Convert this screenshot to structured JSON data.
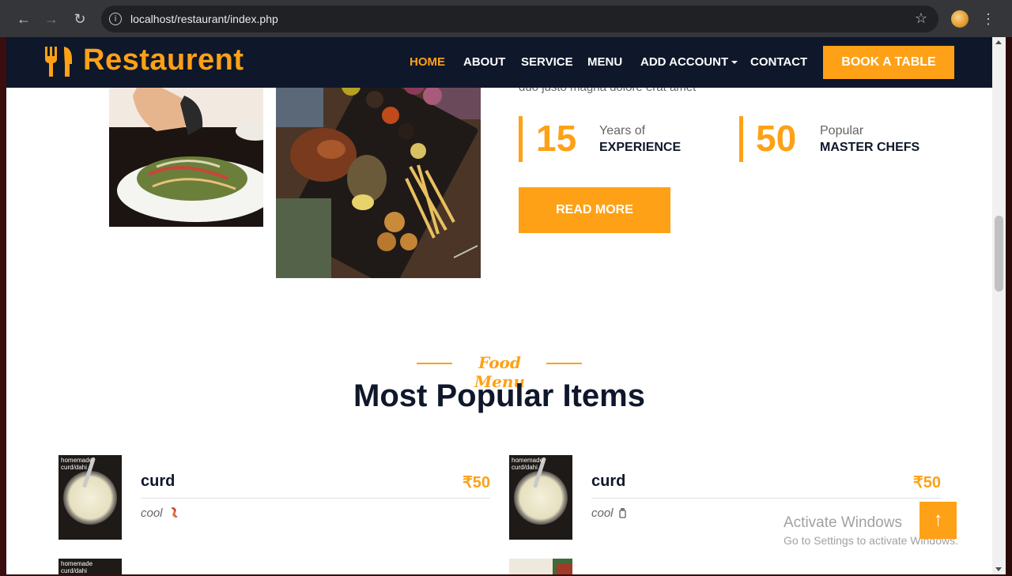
{
  "browser": {
    "url": "localhost/restaurant/index.php",
    "back_icon": "arrow-left-icon",
    "forward_icon": "arrow-right-icon",
    "reload_icon": "reload-icon",
    "back_glyph": "←",
    "forward_glyph": "→",
    "reload_glyph": "↻",
    "info_glyph": "i",
    "star_glyph": "☆",
    "menu_glyph": "⋮"
  },
  "navbar": {
    "brand": "Restaurent",
    "links": [
      "HOME",
      "ABOUT",
      "SERVICE",
      "MENU",
      "ADD ACCOUNT",
      "CONTACT"
    ],
    "active": "HOME",
    "cta": "BOOK A TABLE"
  },
  "about": {
    "cut_text": "duo justo magna dolore erat amet",
    "stats": [
      {
        "number": "15",
        "small": "Years of",
        "strong": "EXPERIENCE"
      },
      {
        "number": "50",
        "small": "Popular",
        "strong": "MASTER CHEFS"
      }
    ],
    "read_more": "READ MORE"
  },
  "menu": {
    "tag": "Food Menu",
    "title": "Most Popular Items",
    "items": [
      {
        "name": "curd",
        "price": "₹50",
        "desc": "cool",
        "image_label": "homemade curd/dahi"
      },
      {
        "name": "curd",
        "price": "₹50",
        "desc": "cool",
        "image_label": "homemade curd/dahi"
      }
    ],
    "partial_image_label": "homemade curd/dahi"
  },
  "windows_watermark": {
    "title": "Activate Windows",
    "subtitle": "Go to Settings to activate Windows."
  },
  "back_to_top_glyph": "↑",
  "colors": {
    "primary": "#fea116",
    "dark": "#0f172b",
    "text_muted": "#666565"
  }
}
